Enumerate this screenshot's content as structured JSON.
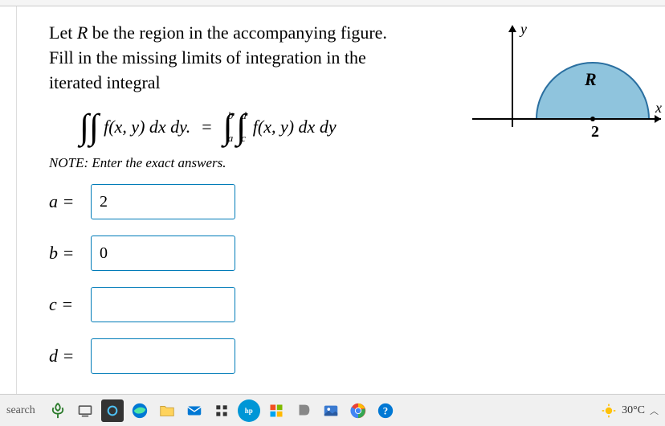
{
  "problem": {
    "line1": "Let R be the region in the accompanying figure.",
    "line2": "Fill in the missing limits of integration in the",
    "line3": "iterated integral",
    "integral_left": "∬ f(x,y) dx dy.",
    "equals": "=",
    "integral_right": "f(x, y) dx dy",
    "lim_a": "a",
    "lim_b": "b",
    "lim_c": "c",
    "lim_d": "d",
    "note": "NOTE: Enter the exact answers."
  },
  "answers": {
    "a": {
      "label": "a =",
      "value": "2"
    },
    "b": {
      "label": "b =",
      "value": "0"
    },
    "c": {
      "label": "c =",
      "value": ""
    },
    "d": {
      "label": "d =",
      "value": ""
    }
  },
  "figure": {
    "y_label": "y",
    "x_label": "x",
    "region_label": "R",
    "center_tick": "2"
  },
  "taskbar": {
    "search": "search",
    "temp": "30°C"
  }
}
